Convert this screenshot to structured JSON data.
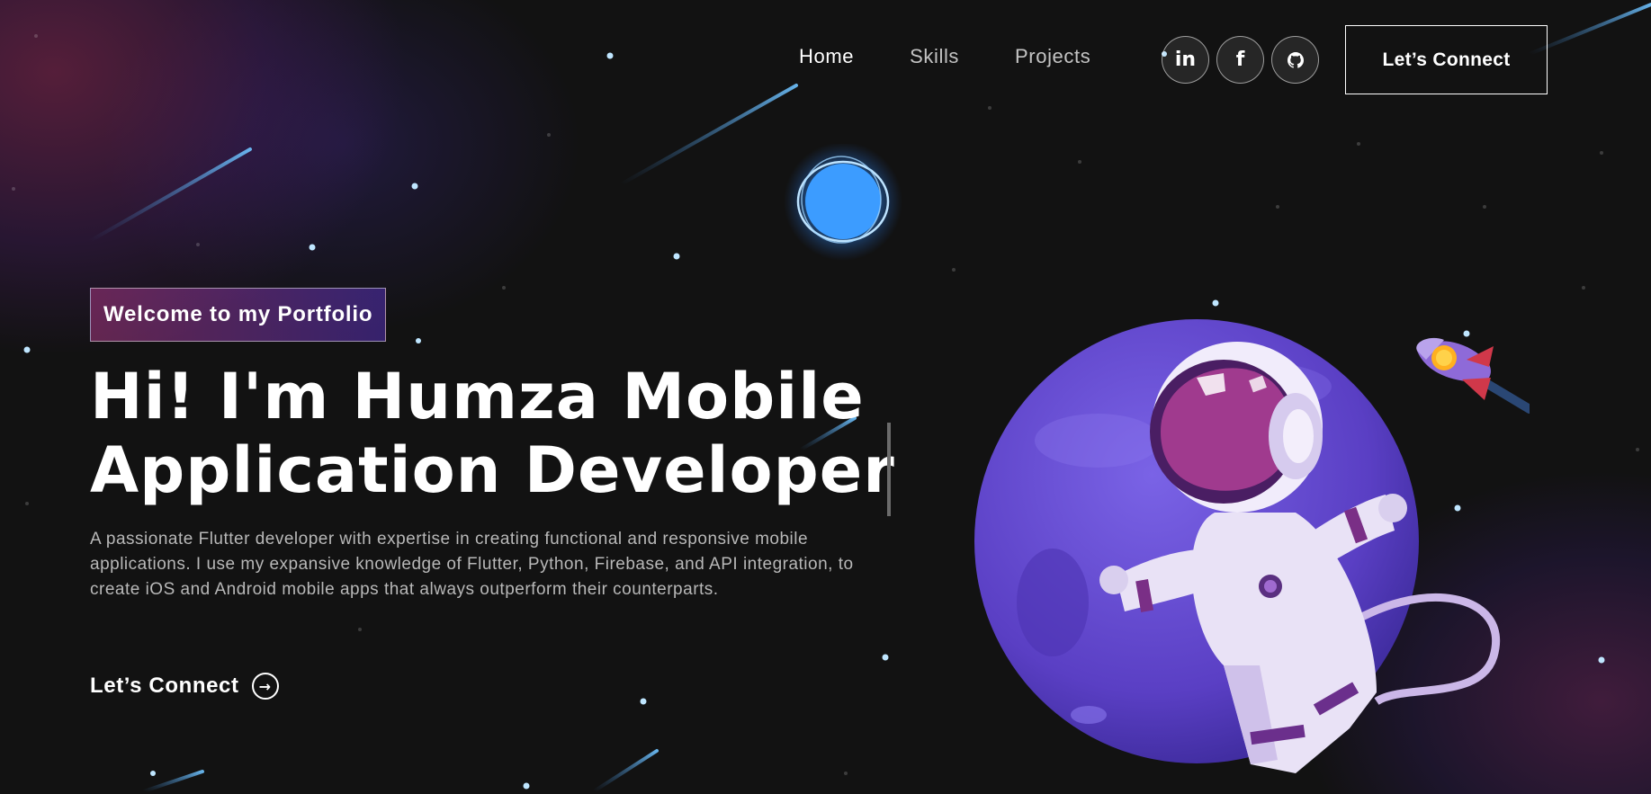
{
  "navbar": {
    "links": [
      {
        "label": "Home",
        "active": true
      },
      {
        "label": "Skills",
        "active": false
      },
      {
        "label": "Projects",
        "active": false
      }
    ],
    "social": [
      {
        "icon": "linkedin-icon",
        "glyph": "in"
      },
      {
        "icon": "facebook-icon",
        "glyph": "f"
      },
      {
        "icon": "github-icon",
        "glyph": "gh"
      }
    ],
    "connect_label": "Let’s Connect"
  },
  "hero": {
    "tagline": "Welcome to my Portfolio",
    "title_line1": "Hi! I'm Humza Mobile",
    "title_line2": "Application Developer",
    "description": "A passionate Flutter developer with expertise in creating functional and responsive mobile applications. I use my expansive knowledge of Flutter, Python, Firebase, and API integration, to create iOS and Android mobile apps that always outperform their counterparts.",
    "cta_label": "Let’s Connect",
    "cta_icon": "arrow-right-circle-icon"
  },
  "colors": {
    "background": "#121212",
    "tagline_gradient_start": "#AA367C",
    "tagline_gradient_end": "#4A2FBD",
    "planet": "#6A4FD6",
    "orb": "#4AA8FF"
  }
}
